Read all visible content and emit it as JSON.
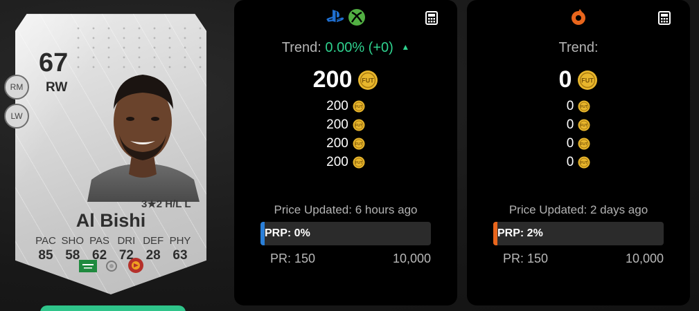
{
  "card": {
    "rating": "67",
    "position": "RW",
    "alt_positions": [
      "RM",
      "LW"
    ],
    "skills_line": "3★2 H/L L",
    "name": "Al Bishi",
    "stats": [
      {
        "label": "PAC",
        "value": "85"
      },
      {
        "label": "SHO",
        "value": "58"
      },
      {
        "label": "PAS",
        "value": "62"
      },
      {
        "label": "DRI",
        "value": "72"
      },
      {
        "label": "DEF",
        "value": "28"
      },
      {
        "label": "PHY",
        "value": "63"
      }
    ],
    "badges": [
      "saudi-flag-icon",
      "league-logo-icon",
      "club-crest-icon"
    ]
  },
  "console_panel": {
    "platform_icons": [
      "playstation-icon",
      "xbox-icon"
    ],
    "trend_label": "Trend:",
    "trend_value": "0.00% (+0)",
    "trend_arrow": "▲",
    "main_price": "200",
    "other_prices": [
      "200",
      "200",
      "200",
      "200"
    ],
    "updated": "Price Updated: 6 hours ago",
    "prp_label": "PRP: 0%",
    "prp_percent": 0,
    "prp_color": "#2a7fd8",
    "pr_min": "PR: 150",
    "pr_max": "10,000"
  },
  "pc_panel": {
    "platform_icons": [
      "origin-icon"
    ],
    "trend_label": "Trend:",
    "main_price": "0",
    "other_prices": [
      "0",
      "0",
      "0",
      "0"
    ],
    "updated": "Price Updated: 2 days ago",
    "prp_label": "PRP: 2%",
    "prp_percent": 2,
    "prp_color": "#e8651c",
    "pr_min": "PR: 150",
    "pr_max": "10,000"
  },
  "coin_label": "FUT",
  "colors": {
    "trend_positive": "#2fd28f",
    "coin_gold": "#e8b62c",
    "action_green": "#2fc48a"
  }
}
